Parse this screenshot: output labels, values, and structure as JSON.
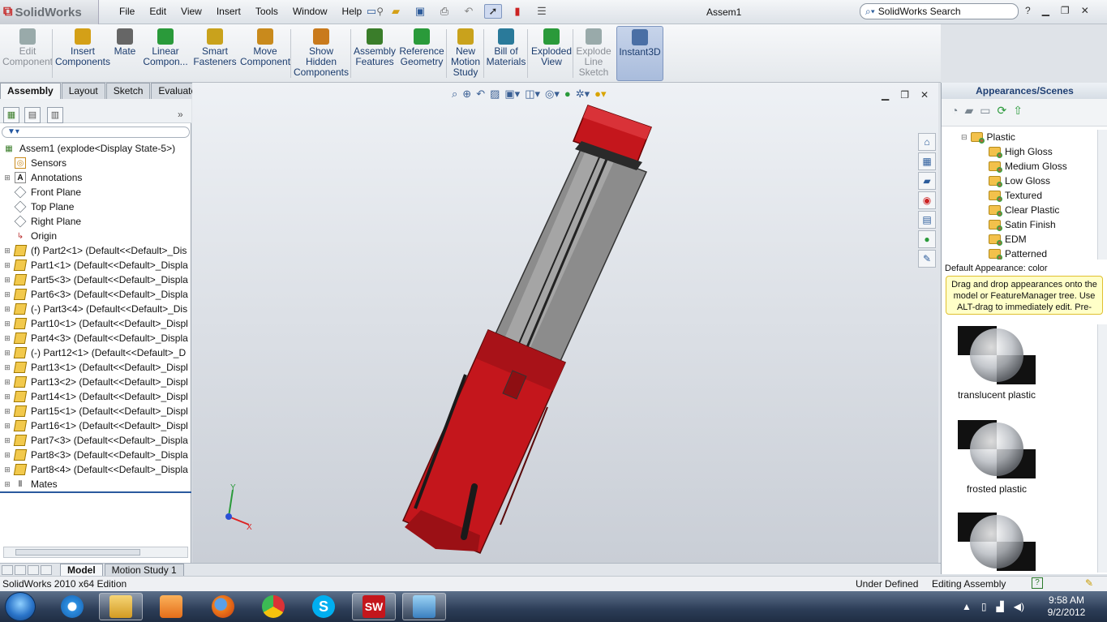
{
  "app": {
    "logo_text": "SolidWorks",
    "doc_title": "Assem1",
    "search_placeholder": "SolidWorks Search",
    "help_icon": "?"
  },
  "menu": [
    "File",
    "Edit",
    "View",
    "Insert",
    "Tools",
    "Window",
    "Help"
  ],
  "commands": [
    {
      "label": "Edit\nComponent",
      "disabled": true
    },
    {
      "label": "Insert\nComponents"
    },
    {
      "label": "Mate"
    },
    {
      "label": "Linear\nCompon..."
    },
    {
      "label": "Smart\nFasteners"
    },
    {
      "label": "Move\nComponent"
    },
    {
      "label": "Show\nHidden\nComponents"
    },
    {
      "label": "Assembly\nFeatures"
    },
    {
      "label": "Reference\nGeometry"
    },
    {
      "label": "New\nMotion\nStudy"
    },
    {
      "label": "Bill of\nMaterials"
    },
    {
      "label": "Exploded\nView"
    },
    {
      "label": "Explode\nLine\nSketch",
      "disabled": true
    },
    {
      "label": "Instant3D",
      "active": true
    }
  ],
  "cm_tabs": [
    "Assembly",
    "Layout",
    "Sketch",
    "Evaluate"
  ],
  "tree": [
    {
      "label": "Assem1  (explode<Display State-5>)",
      "icon": "assembly-icon",
      "level": 0
    },
    {
      "label": "Sensors",
      "icon": "sensor-icon",
      "level": 1
    },
    {
      "label": "Annotations",
      "icon": "annotation-icon",
      "level": 1,
      "expand": true
    },
    {
      "label": "Front Plane",
      "icon": "plane-icon",
      "level": 1
    },
    {
      "label": "Top Plane",
      "icon": "plane-icon",
      "level": 1
    },
    {
      "label": "Right Plane",
      "icon": "plane-icon",
      "level": 1
    },
    {
      "label": "Origin",
      "icon": "origin-icon",
      "level": 1
    },
    {
      "label": "(f) Part2<1> (Default<<Default>_Dis",
      "icon": "part-icon",
      "level": 1,
      "expand": true
    },
    {
      "label": "Part1<1> (Default<<Default>_Displa",
      "icon": "part-icon",
      "level": 1,
      "expand": true
    },
    {
      "label": "Part5<3> (Default<<Default>_Displa",
      "icon": "part-icon",
      "level": 1,
      "expand": true
    },
    {
      "label": "Part6<3> (Default<<Default>_Displa",
      "icon": "part-icon",
      "level": 1,
      "expand": true
    },
    {
      "label": "(-) Part3<4> (Default<<Default>_Dis",
      "icon": "part-icon",
      "level": 1,
      "expand": true
    },
    {
      "label": "Part10<1> (Default<<Default>_Displ",
      "icon": "part-icon",
      "level": 1,
      "expand": true
    },
    {
      "label": "Part4<3> (Default<<Default>_Displa",
      "icon": "part-icon",
      "level": 1,
      "expand": true
    },
    {
      "label": "(-) Part12<1> (Default<<Default>_D",
      "icon": "part-icon",
      "level": 1,
      "expand": true
    },
    {
      "label": "Part13<1> (Default<<Default>_Displ",
      "icon": "part-icon",
      "level": 1,
      "expand": true
    },
    {
      "label": "Part13<2> (Default<<Default>_Displ",
      "icon": "part-icon",
      "level": 1,
      "expand": true
    },
    {
      "label": "Part14<1> (Default<<Default>_Displ",
      "icon": "part-icon",
      "level": 1,
      "expand": true
    },
    {
      "label": "Part15<1> (Default<<Default>_Displ",
      "icon": "part-icon",
      "level": 1,
      "expand": true
    },
    {
      "label": "Part16<1> (Default<<Default>_Displ",
      "icon": "part-icon",
      "level": 1,
      "expand": true
    },
    {
      "label": "Part7<3> (Default<<Default>_Displa",
      "icon": "part-icon",
      "level": 1,
      "expand": true
    },
    {
      "label": "Part8<3> (Default<<Default>_Displa",
      "icon": "part-icon",
      "level": 1,
      "expand": true
    },
    {
      "label": "Part8<4> (Default<<Default>_Displa",
      "icon": "part-icon",
      "level": 1,
      "expand": true
    },
    {
      "label": "Mates",
      "icon": "mates-icon",
      "level": 1,
      "expand": true
    }
  ],
  "appearances": {
    "title": "Appearances/Scenes",
    "folder": "Plastic",
    "items": [
      "High Gloss",
      "Medium Gloss",
      "Low Gloss",
      "Textured",
      "Clear Plastic",
      "Satin Finish",
      "EDM",
      "Patterned"
    ],
    "default_appearance": "Default Appearance: color",
    "tip": "Drag and drop appearances onto the model or FeatureManager tree.  Use ALT-drag to immediately edit.  Pre-sele...",
    "swatches": [
      "translucent plastic",
      "frosted plastic"
    ]
  },
  "bottom_tabs": [
    "Model",
    "Motion Study 1"
  ],
  "status": {
    "edition": "SolidWorks 2010 x64 Edition",
    "state": "Under Defined",
    "mode": "Editing Assembly"
  },
  "clock": {
    "time": "9:58 AM",
    "date": "9/2/2012"
  },
  "colors": {
    "model_red": "#c4161c",
    "accent": "#2a5a9e"
  }
}
